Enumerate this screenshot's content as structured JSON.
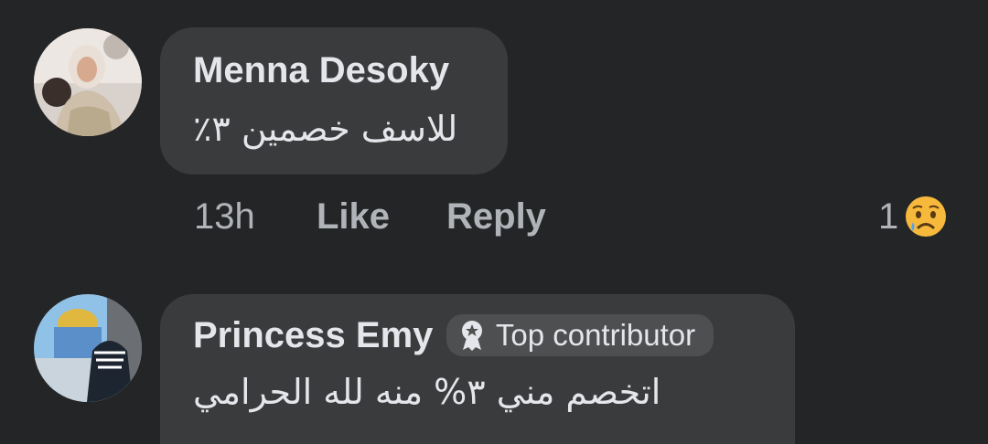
{
  "comments": [
    {
      "author": "Menna Desoky",
      "text": "للاسف خصمين ٣٪",
      "time": "13h",
      "like_label": "Like",
      "reply_label": "Reply",
      "reaction_count": "1",
      "reaction_icon": "sad-face-icon"
    },
    {
      "author": "Princess Emy",
      "badge": "Top contributor",
      "badge_icon": "award-ribbon-icon",
      "text": "اتخصم مني ٣% منه لله الحرامي"
    }
  ],
  "colors": {
    "background": "#242526",
    "bubble": "#3a3b3c",
    "primary_text": "#e4e6eb",
    "secondary_text": "#b0b3b8",
    "badge_bg": "#4e4f50"
  }
}
